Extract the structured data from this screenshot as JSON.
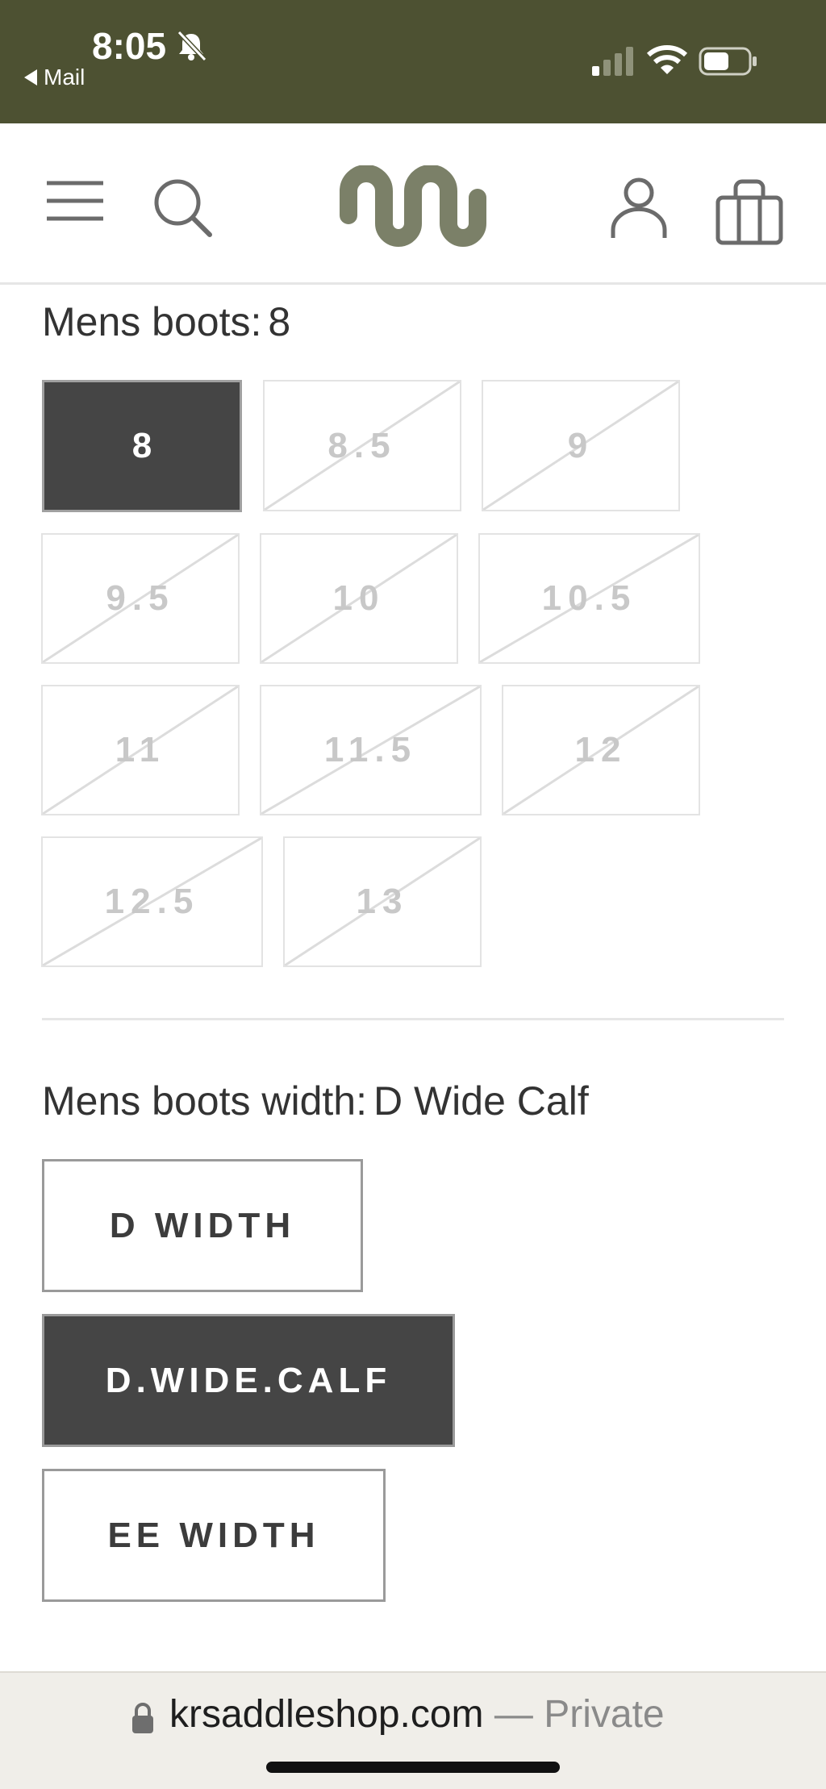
{
  "status_bar": {
    "time": "8:05",
    "back_app": "Mail"
  },
  "header": {
    "icons": [
      "menu-icon",
      "search-icon",
      "logo-icon",
      "account-icon",
      "bag-icon"
    ],
    "bar_color": "#4d5132",
    "logo_color": "#7b8068"
  },
  "size_section": {
    "label": "Mens boots:",
    "selected_value": "8",
    "options": [
      {
        "label": "8",
        "selected": true,
        "available": true
      },
      {
        "label": "8.5",
        "selected": false,
        "available": false
      },
      {
        "label": "9",
        "selected": false,
        "available": false
      },
      {
        "label": "9.5",
        "selected": false,
        "available": false
      },
      {
        "label": "10",
        "selected": false,
        "available": false
      },
      {
        "label": "10.5",
        "selected": false,
        "available": false
      },
      {
        "label": "11",
        "selected": false,
        "available": false
      },
      {
        "label": "11.5",
        "selected": false,
        "available": false
      },
      {
        "label": "12",
        "selected": false,
        "available": false
      },
      {
        "label": "12.5",
        "selected": false,
        "available": false
      },
      {
        "label": "13",
        "selected": false,
        "available": false
      }
    ]
  },
  "width_section": {
    "label": "Mens boots width:",
    "selected_value": "D Wide Calf",
    "options": [
      {
        "label": "D WIDTH",
        "selected": false
      },
      {
        "label": "D.WIDE.CALF",
        "selected": true
      },
      {
        "label": "EE WIDTH",
        "selected": false
      }
    ]
  },
  "browser": {
    "domain": "krsaddleshop.com",
    "suffix": " — Private"
  },
  "colors": {
    "selected_bg": "#454545",
    "unavailable_text": "#c8c8c8"
  }
}
